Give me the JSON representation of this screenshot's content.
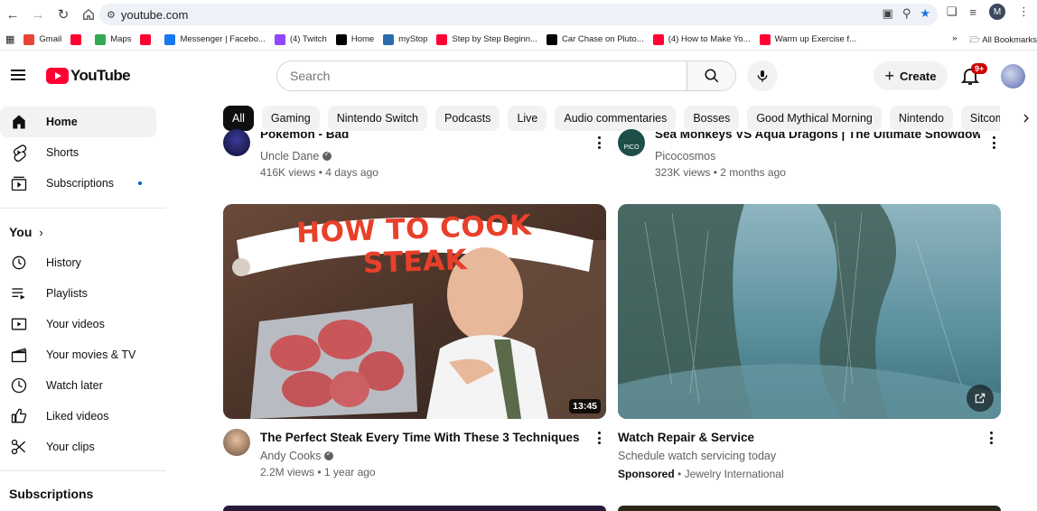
{
  "browser": {
    "url": "youtube.com",
    "profile_initial": "M",
    "bookmarks": [
      {
        "label": "Gmail",
        "color": "#ea4335"
      },
      {
        "label": "",
        "color": "#ff0033"
      },
      {
        "label": "Maps",
        "color": "#34a853"
      },
      {
        "label": "",
        "color": "#ff0033"
      },
      {
        "label": "Messenger | Facebo...",
        "color": "#1877f2"
      },
      {
        "label": "(4) Twitch",
        "color": "#9146ff"
      },
      {
        "label": "Home",
        "color": "#000000"
      },
      {
        "label": "myStop",
        "color": "#2b6cb0"
      },
      {
        "label": "Step by Step Beginn...",
        "color": "#ff0033"
      },
      {
        "label": "Car Chase on Pluto...",
        "color": "#000000"
      },
      {
        "label": "(4) How to Make Yo...",
        "color": "#ff0033"
      },
      {
        "label": "Warm up Exercise f...",
        "color": "#ff0033"
      }
    ],
    "overflow": "»",
    "all_bookmarks": "All Bookmarks"
  },
  "header": {
    "logo_text": "YouTube",
    "search_placeholder": "Search",
    "create_label": "Create",
    "notification_count": "9+"
  },
  "sidebar": {
    "main": [
      {
        "label": "Home",
        "icon": "home-icon",
        "active": true
      },
      {
        "label": "Shorts",
        "icon": "shorts-icon"
      },
      {
        "label": "Subscriptions",
        "icon": "subscriptions-icon",
        "dot": true
      }
    ],
    "you_heading": "You",
    "you_items": [
      {
        "label": "History",
        "icon": "history-icon"
      },
      {
        "label": "Playlists",
        "icon": "playlists-icon"
      },
      {
        "label": "Your videos",
        "icon": "your-videos-icon"
      },
      {
        "label": "Your movies & TV",
        "icon": "movies-icon"
      },
      {
        "label": "Watch later",
        "icon": "watch-later-icon"
      },
      {
        "label": "Liked videos",
        "icon": "liked-icon"
      },
      {
        "label": "Your clips",
        "icon": "clips-icon"
      }
    ],
    "subscriptions_heading": "Subscriptions"
  },
  "chips": [
    "All",
    "Gaming",
    "Nintendo Switch",
    "Podcasts",
    "Live",
    "Audio commentaries",
    "Bosses",
    "Good Mythical Morning",
    "Nintendo",
    "Sitcoms"
  ],
  "videos": {
    "top_left": {
      "title": "Pokémon - Bad",
      "channel": "Uncle Dane",
      "verified": true,
      "meta": "416K views • 4 days ago"
    },
    "top_right": {
      "title": "Sea Monkeys VS Aqua Dragons | The Ultimate Showdown!",
      "channel": "Picocosmos",
      "channel_badge": "PICO",
      "meta": "323K views • 2 months ago"
    },
    "main_left": {
      "title": "The Perfect Steak Every Time With These 3 Techniques",
      "channel": "Andy Cooks",
      "verified": true,
      "meta": "2.2M views • 1 year ago",
      "duration": "13:45",
      "thumb_text": "HOW TO COOK STEAK"
    },
    "main_right": {
      "title": "Watch Repair & Service",
      "description": "Schedule watch servicing today",
      "sponsored": "Sponsored",
      "advertiser": "Jewelry International"
    }
  }
}
